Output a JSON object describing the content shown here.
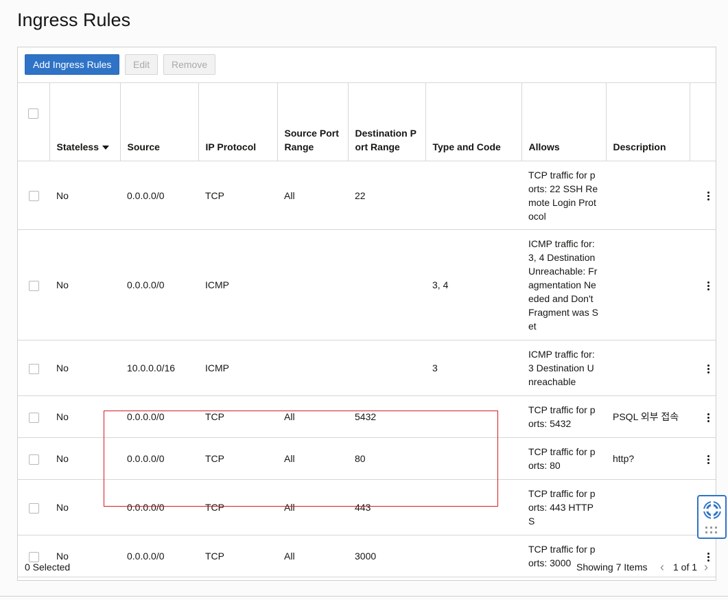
{
  "page": {
    "title": "Ingress Rules"
  },
  "toolbar": {
    "add_label": "Add Ingress Rules",
    "edit_label": "Edit",
    "remove_label": "Remove"
  },
  "table": {
    "headers": {
      "stateless": "Stateless",
      "source": "Source",
      "ip_protocol": "IP Protocol",
      "source_port_range": "Source Port Range",
      "destination_port_range": "Destination Port Range",
      "type_and_code": "Type and Code",
      "allows": "Allows",
      "description": "Description"
    },
    "rows": [
      {
        "stateless": "No",
        "source": "0.0.0.0/0",
        "protocol": "TCP",
        "src_port": "All",
        "dst_port": "22",
        "type_code": "",
        "allows": "TCP traffic for ports: 22 SSH Remote Login Protocol",
        "description": ""
      },
      {
        "stateless": "No",
        "source": "0.0.0.0/0",
        "protocol": "ICMP",
        "src_port": "",
        "dst_port": "",
        "type_code": "3, 4",
        "allows": "ICMP traffic for: 3, 4 Destination Unreachable: Fragmentation Needed and Don't Fragment was Set",
        "description": ""
      },
      {
        "stateless": "No",
        "source": "10.0.0.0/16",
        "protocol": "ICMP",
        "src_port": "",
        "dst_port": "",
        "type_code": "3",
        "allows": "ICMP traffic for: 3 Destination Unreachable",
        "description": ""
      },
      {
        "stateless": "No",
        "source": "0.0.0.0/0",
        "protocol": "TCP",
        "src_port": "All",
        "dst_port": "5432",
        "type_code": "",
        "allows": "TCP traffic for ports: 5432",
        "description": "PSQL 외부 접속"
      },
      {
        "stateless": "No",
        "source": "0.0.0.0/0",
        "protocol": "TCP",
        "src_port": "All",
        "dst_port": "80",
        "type_code": "",
        "allows": "TCP traffic for ports: 80",
        "description": "http?"
      },
      {
        "stateless": "No",
        "source": "0.0.0.0/0",
        "protocol": "TCP",
        "src_port": "All",
        "dst_port": "443",
        "type_code": "",
        "allows": "TCP traffic for ports: 443 HTTPS",
        "description": ""
      },
      {
        "stateless": "No",
        "source": "0.0.0.0/0",
        "protocol": "TCP",
        "src_port": "All",
        "dst_port": "3000",
        "type_code": "",
        "allows": "TCP traffic for ports: 3000",
        "description": ""
      }
    ]
  },
  "footer": {
    "selected": "0 Selected",
    "showing": "Showing 7 Items",
    "pagination": "1 of 1"
  },
  "icons": {
    "sort": "sort-descending-icon",
    "kebab": "kebab-menu-icon",
    "help": "lifebuoy-icon"
  },
  "colors": {
    "primary": "#2f73c7",
    "highlight": "#d01c1c"
  }
}
